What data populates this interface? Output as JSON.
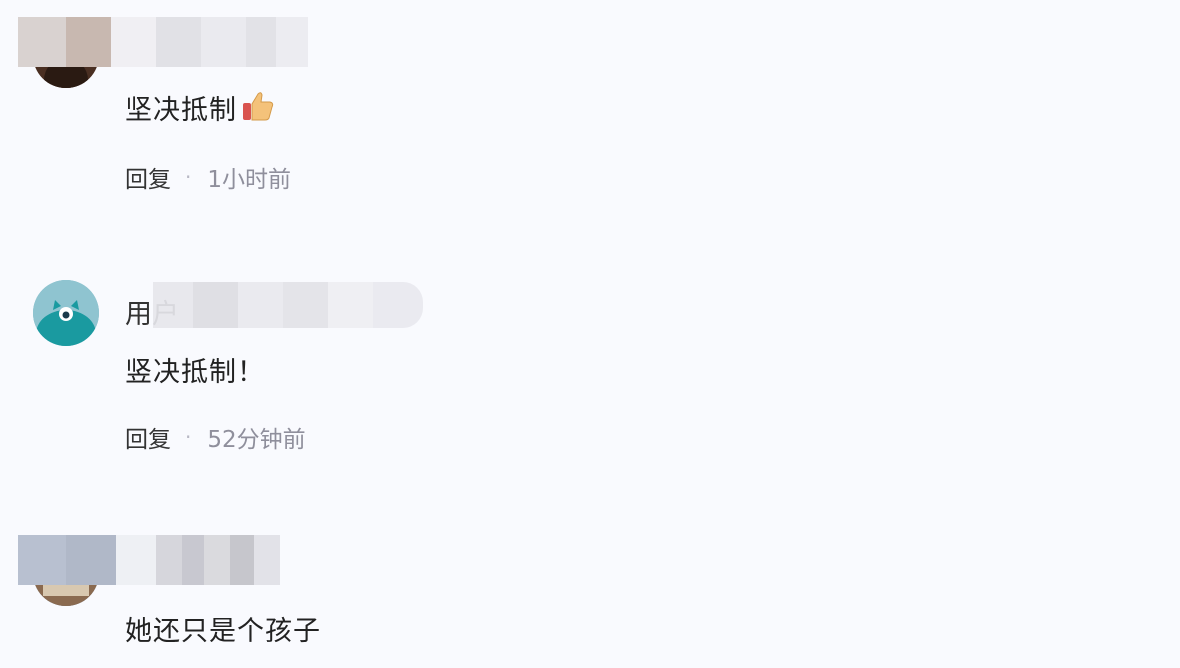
{
  "comments": [
    {
      "text": "坚决抵制",
      "emoji": "thumbs-up-icon",
      "reply_label": "回复",
      "separator": "·",
      "time": "1小时前"
    },
    {
      "username_partial": "用户",
      "text": "竖决抵制！",
      "reply_label": "回复",
      "separator": "·",
      "time": "52分钟前"
    },
    {
      "text": "她还只是个孩子"
    }
  ],
  "colors": {
    "background": "#f9fafe",
    "text": "#222222",
    "meta": "#8f8f9c",
    "avatar2": "#6aaab8"
  }
}
